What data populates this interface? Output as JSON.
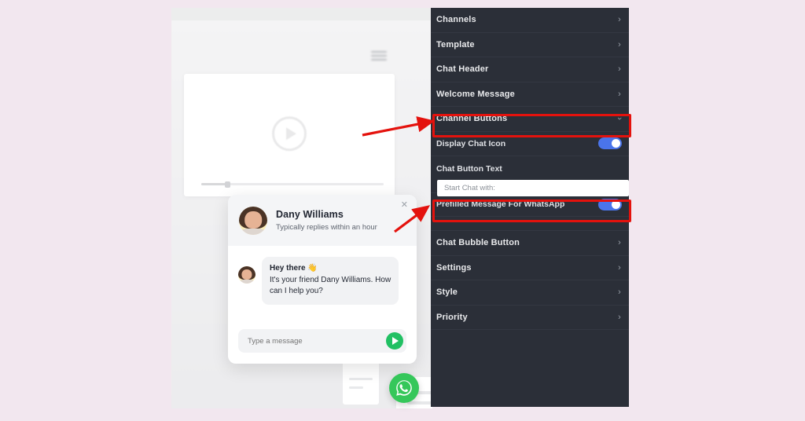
{
  "theme": {
    "page_background": "#f2e7ef",
    "sidebar_background": "#2b2f38",
    "toggle_on_color": "#4a74ea",
    "highlight_color": "#e4120d",
    "whatsapp_green": "#35c75a",
    "send_green": "#21c063"
  },
  "preview": {
    "video_play_icon": "play-icon",
    "menu_icon": "hamburger-icon"
  },
  "chat_widget": {
    "agent_name": "Dany Williams",
    "agent_status": "Typically replies within an hour",
    "close_icon": "close-icon",
    "message_line1": "Hey there 👋",
    "message_line2": "It's your friend Dany Williams. How",
    "message_line3": "can I help you?",
    "input_placeholder": "Type a message",
    "input_value": "",
    "send_icon": "send-icon"
  },
  "floating_button": {
    "icon": "whatsapp-icon",
    "label": "WhatsApp"
  },
  "sidebar": {
    "items": [
      {
        "label": "Channels",
        "chevron": "›",
        "expanded": false
      },
      {
        "label": "Template",
        "chevron": "›",
        "expanded": false
      },
      {
        "label": "Chat Header",
        "chevron": "›",
        "expanded": false
      },
      {
        "label": "Welcome Message",
        "chevron": "›",
        "expanded": false
      },
      {
        "label": "Channel Buttons",
        "chevron": "›",
        "expanded": true
      }
    ],
    "expanded_section": {
      "display_chat_icon": {
        "label": "Display Chat Icon",
        "toggle": "on"
      },
      "chat_button_text": {
        "label": "Chat Button Text",
        "placeholder": "Start Chat with:",
        "value": ""
      },
      "prefilled_message": {
        "label": "Prefilled Message For WhatsApp",
        "toggle": "on"
      }
    },
    "items_after": [
      {
        "label": "Chat Bubble Button",
        "chevron": "›"
      },
      {
        "label": "Settings",
        "chevron": "›"
      },
      {
        "label": "Style",
        "chevron": "›"
      },
      {
        "label": "Priority",
        "chevron": "›"
      }
    ]
  },
  "annotations": {
    "highlight_1": "Channel Buttons",
    "highlight_2": "Prefilled Message For WhatsApp",
    "arrow_1": "arrow-to-channel-buttons",
    "arrow_2": "arrow-to-prefilled-message"
  }
}
